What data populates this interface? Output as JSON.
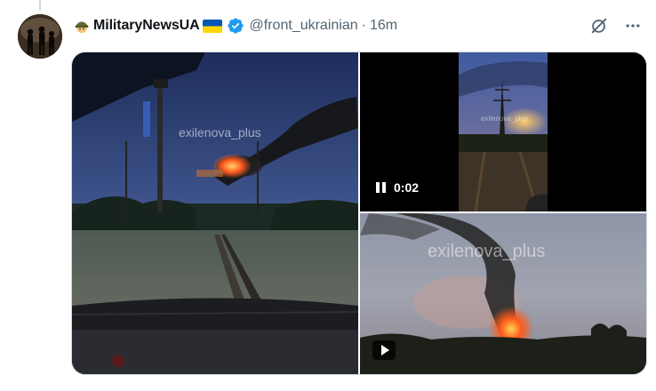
{
  "tweet": {
    "display_name": "MilitaryNewsUA",
    "handle": "@front_ukrainian",
    "separator": "·",
    "time": "16m"
  },
  "icons": {
    "avatar": "avatar-soldiers",
    "soldier_emoji": "soldier-helmet-icon",
    "flag": "ukraine-flag-icon",
    "verified": "verified-badge-icon",
    "grok": "grok-icon",
    "more": "more-icon"
  },
  "media": {
    "left_watermark": "exilenova_plus",
    "top_right_watermark": "exilenova_plus",
    "top_right_video_time": "0:02",
    "bottom_right_watermark": "exilenova_plus"
  },
  "colors": {
    "verified_blue": "#1d9bf0",
    "flag_blue": "#0057b7",
    "flag_yellow": "#ffd700",
    "muted_text": "#536471"
  }
}
